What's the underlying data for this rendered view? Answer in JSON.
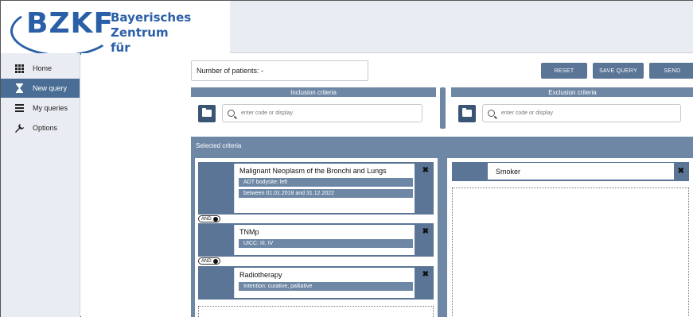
{
  "header": {
    "logo_text": "BZKF",
    "logo_sub_line1": "Bayerisches Zentrum",
    "logo_sub_line2": "für Krebsforschung"
  },
  "sidebar": {
    "items": [
      {
        "label": "Home",
        "icon": "grid-icon"
      },
      {
        "label": "New query",
        "icon": "hourglass-icon",
        "active": true
      },
      {
        "label": "My queries",
        "icon": "list-icon"
      },
      {
        "label": "Options",
        "icon": "wrench-icon"
      }
    ]
  },
  "toolbar": {
    "patients_label": "Number of patients: -",
    "reset_label": "RESET",
    "save_label": "SAVE QUERY",
    "send_label": "SEND"
  },
  "inclusion": {
    "title": "Inclusion criteria",
    "placeholder": "enter code or display"
  },
  "exclusion": {
    "title": "Exclusion criteria",
    "placeholder": "enter code or display"
  },
  "selected": {
    "title": "Selected criteria",
    "and_label": "AND",
    "inclusion_cards": [
      {
        "title": "Malignant Neoplasm of the Bronchi and Lungs",
        "chips": [
          "ADT bodysite: left",
          "between 01.01.2018 and 31.12.2022"
        ]
      },
      {
        "title": "TNMp",
        "chips": [
          "UICC: III, IV"
        ]
      },
      {
        "title": "Radiotherapy",
        "chips": [
          "Intention: curative, palliative"
        ]
      }
    ],
    "exclusion_cards": [
      {
        "title": "Smoker"
      }
    ]
  },
  "colors": {
    "accent": "#5a7596",
    "header_bar": "#6d87a5",
    "logo": "#2a5fa8"
  }
}
